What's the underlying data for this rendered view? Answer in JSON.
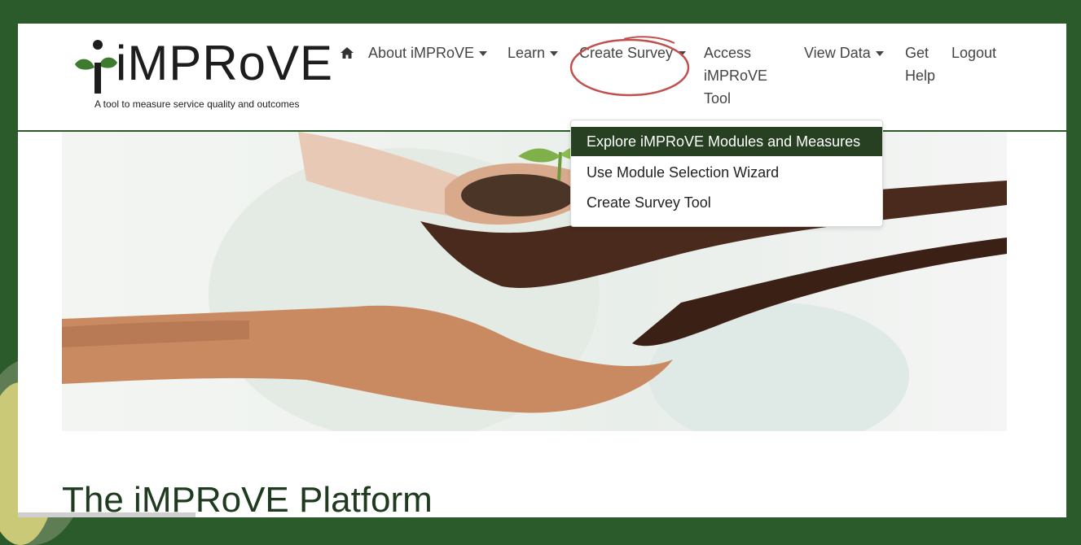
{
  "brand": {
    "name": "iMPRoVE",
    "tagline": "A tool to measure service quality and outcomes"
  },
  "nav": {
    "home_icon": "home-icon",
    "items": [
      {
        "label": "About iMPRoVE",
        "has_dropdown": true
      },
      {
        "label": "Learn",
        "has_dropdown": true
      },
      {
        "label": "Create Survey",
        "has_dropdown": true
      },
      {
        "label": "Access iMPRoVE Tool",
        "lines": [
          "Access",
          "iMPRoVE",
          "Tool"
        ],
        "has_dropdown": false
      },
      {
        "label": "View Data",
        "has_dropdown": true
      },
      {
        "label": "Get Help",
        "lines": [
          "Get",
          "Help"
        ],
        "has_dropdown": false
      },
      {
        "label": "Logout",
        "has_dropdown": false
      }
    ]
  },
  "dropdown": {
    "parent": "Create Survey",
    "items": [
      {
        "label": "Explore iMPRoVE Modules and Measures",
        "highlighted": true
      },
      {
        "label": "Use Module Selection Wizard",
        "highlighted": false
      },
      {
        "label": "Create Survey Tool",
        "highlighted": false
      }
    ]
  },
  "hero": {
    "image": "hands-holding-seedling"
  },
  "main": {
    "heading": "The iMPRoVE Platform"
  },
  "colors": {
    "frame": "#2b5a2b",
    "accent": "#264021",
    "annotation": "#c0504d"
  }
}
